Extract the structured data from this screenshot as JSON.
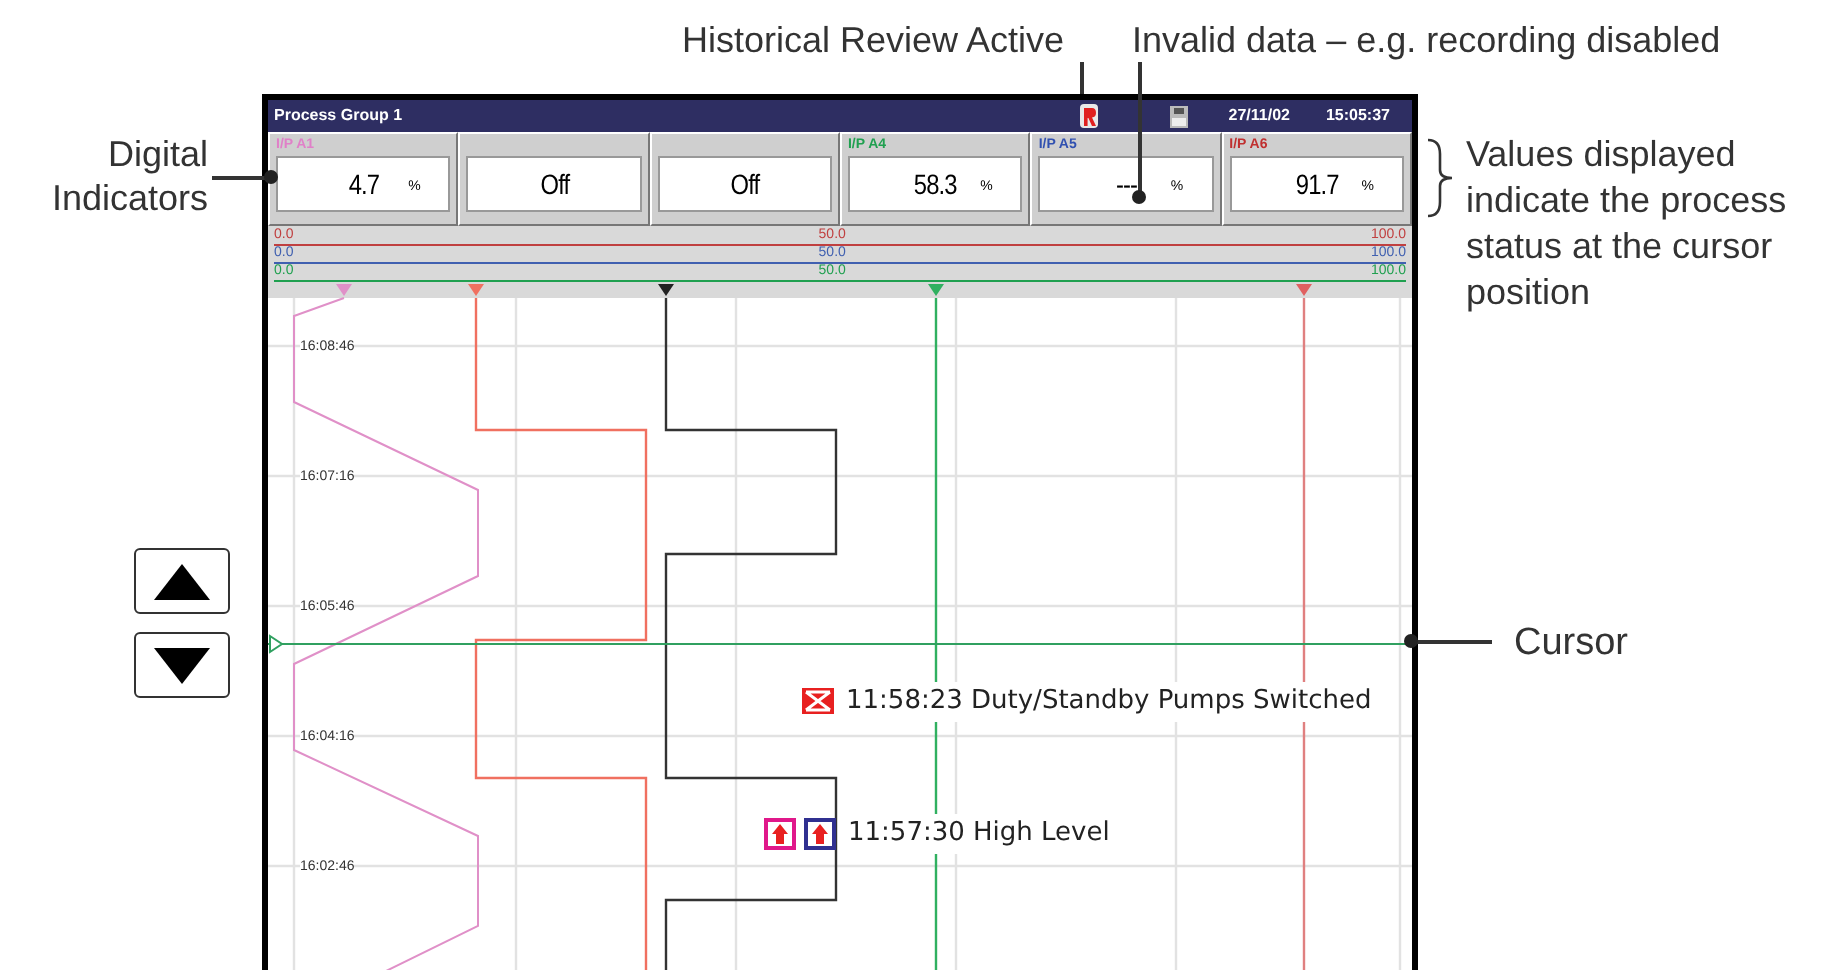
{
  "callouts": {
    "historical_review": "Historical Review Active",
    "invalid_data": "Invalid data – e.g. recording disabled",
    "digital_indicators": "Digital Indicators",
    "values_note": "Values displayed indicate the process status at the cursor position",
    "cursor": "Cursor"
  },
  "screen": {
    "title": "Process Group 1",
    "date": "27/11/02",
    "time": "15:05:37",
    "indicators": [
      {
        "label": "I/P A1",
        "value": "4.7",
        "unit": "%",
        "color": "#e080c8"
      },
      {
        "value": "Off"
      },
      {
        "value": "Off"
      },
      {
        "label": "I/P A4",
        "value": "58.3",
        "unit": "%",
        "color": "#20a050"
      },
      {
        "label": "I/P A5",
        "value": "---",
        "unit": "%",
        "color": "#3050b0"
      },
      {
        "label": "I/P A6",
        "value": "91.7",
        "unit": "%",
        "color": "#c03030"
      }
    ],
    "scales": [
      {
        "min": "0.0",
        "mid": "50.0",
        "max": "100.0",
        "color": "#c04040"
      },
      {
        "min": "0.0",
        "mid": "50.0",
        "max": "100.0",
        "color": "#4060b0"
      },
      {
        "min": "0.0",
        "mid": "50.0",
        "max": "100.0",
        "color": "#20a050"
      }
    ],
    "time_labels": [
      "16:08:46",
      "16:07:16",
      "16:05:46",
      "16:04:16",
      "16:02:46"
    ],
    "events": [
      {
        "kind": "switch",
        "text": "11:58:23 Duty/Standby Pumps Switched"
      },
      {
        "kind": "high-level",
        "text": "11:57:30 High Level"
      }
    ]
  }
}
